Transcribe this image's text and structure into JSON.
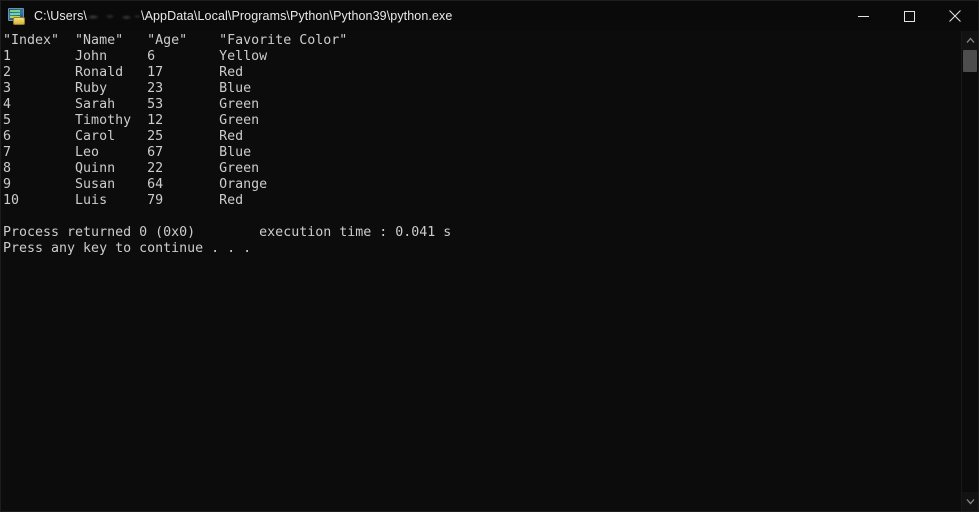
{
  "window": {
    "title_prefix": "C:\\Users\\",
    "title_suffix": "\\AppData\\Local\\Programs\\Python\\Python39\\python.exe",
    "icon": "console-app-icon",
    "background_color": "#0c0c0c",
    "text_color": "#cccccc",
    "titlebar_color": "#0a0a0a"
  },
  "window_controls": {
    "minimize_label": "Minimize",
    "maximize_label": "Maximize",
    "close_label": "Close"
  },
  "console": {
    "header_line": "\"Index\"  \"Name\"   \"Age\"    \"Favorite Color\"",
    "rows": [
      {
        "index": "1",
        "name": "John",
        "age": "6",
        "color": "Yellow"
      },
      {
        "index": "2",
        "name": "Ronald",
        "age": "17",
        "color": "Red"
      },
      {
        "index": "3",
        "name": "Ruby",
        "age": "23",
        "color": "Blue"
      },
      {
        "index": "4",
        "name": "Sarah",
        "age": "53",
        "color": "Green"
      },
      {
        "index": "5",
        "name": "Timothy",
        "age": "12",
        "color": "Green"
      },
      {
        "index": "6",
        "name": "Carol",
        "age": "25",
        "color": "Red"
      },
      {
        "index": "7",
        "name": "Leo",
        "age": "67",
        "color": "Blue"
      },
      {
        "index": "8",
        "name": "Quinn",
        "age": "22",
        "color": "Green"
      },
      {
        "index": "9",
        "name": "Susan",
        "age": "64",
        "color": "Orange"
      },
      {
        "index": "10",
        "name": "Luis",
        "age": "79",
        "color": "Red"
      }
    ],
    "full_text": "\"Index\"  \"Name\"   \"Age\"    \"Favorite Color\"\n1        John     6        Yellow\n2        Ronald   17       Red\n3        Ruby     23       Blue\n4        Sarah    53       Green\n5        Timothy  12       Green\n6        Carol    25       Red\n7        Leo      67       Blue\n8        Quinn    22       Green\n9        Susan    64       Orange\n10       Luis     79       Red\n\nProcess returned 0 (0x0)        execution time : 0.041 s\nPress any key to continue . . .",
    "process_returned_line": "Process returned 0 (0x0)        execution time : 0.041 s",
    "press_any_key_line": "Press any key to continue . . .",
    "exit_code": "0 (0x0)",
    "execution_time": "0.041 s"
  },
  "scrollbar": {
    "up_arrow": "scroll-up-icon",
    "down_arrow": "scroll-down-icon",
    "thumb": "scroll-thumb"
  }
}
